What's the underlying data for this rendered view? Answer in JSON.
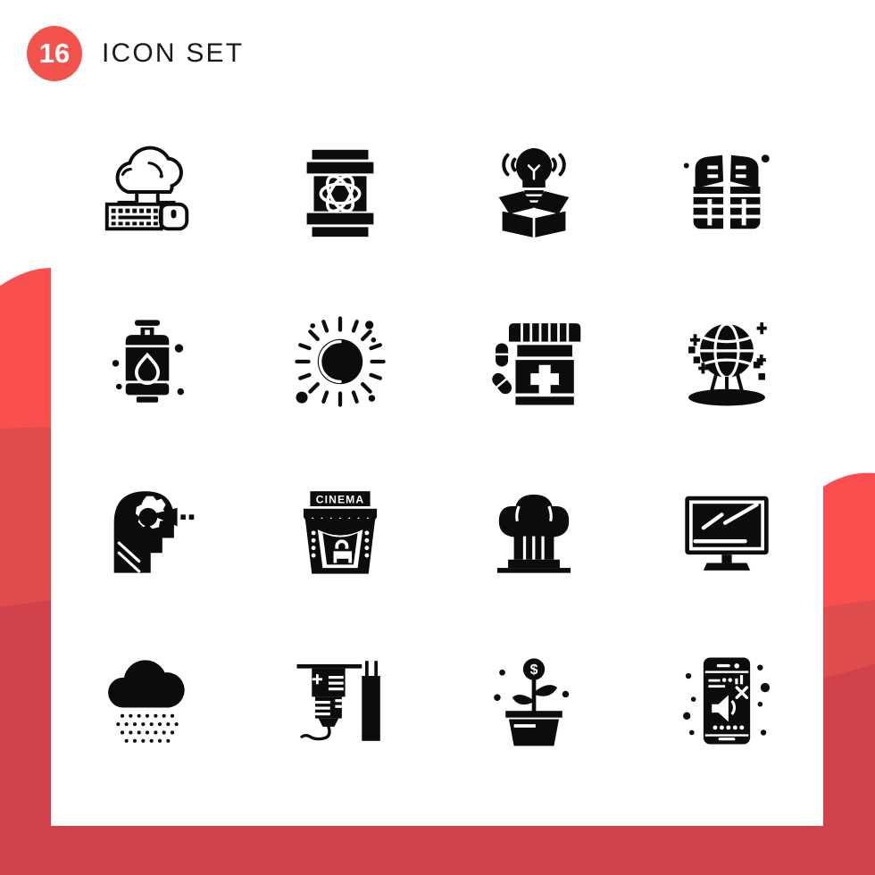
{
  "header": {
    "count": "16",
    "title": "Icon Set",
    "badge_color": "#f4534d",
    "title_color": "#1a1a1a"
  },
  "theme": {
    "background": "#ffffff",
    "accent_light": "#fb4f4f",
    "accent_mid": "#e04545",
    "accent_dark": "#d2424a",
    "icon_color": "#0c0c0c"
  },
  "grid": {
    "columns": 4,
    "rows": 4,
    "total": 16
  },
  "icons": [
    {
      "index": 1,
      "name": "cloud-computing-keyboard-mouse-icon",
      "label": "Cloud computing with keyboard and mouse"
    },
    {
      "index": 2,
      "name": "atom-barrel-icon",
      "label": "Nuclear atom barrel"
    },
    {
      "index": 3,
      "name": "idea-box-bulb-icon",
      "label": "Light bulb in open box"
    },
    {
      "index": 4,
      "name": "life-jacket-icon",
      "label": "Life jacket safety vest"
    },
    {
      "index": 5,
      "name": "gas-cylinder-icon",
      "label": "Gas cylinder with drop"
    },
    {
      "index": 6,
      "name": "sun-icon",
      "label": "Sun with rays"
    },
    {
      "index": 7,
      "name": "medicine-bottle-pills-icon",
      "label": "Medicine bottle with pills"
    },
    {
      "index": 8,
      "name": "globe-monument-icon",
      "label": "Globe sphere monument"
    },
    {
      "index": 9,
      "name": "head-gear-thinking-icon",
      "label": "Head profile with gear"
    },
    {
      "index": 10,
      "name": "cinema-building-icon",
      "label": "Cinema building",
      "sign_text": "CINEMA"
    },
    {
      "index": 11,
      "name": "chef-hat-icon",
      "label": "Chef hat"
    },
    {
      "index": 12,
      "name": "monitor-screen-icon",
      "label": "Computer monitor"
    },
    {
      "index": 13,
      "name": "rain-cloud-icon",
      "label": "Cloud with drizzle"
    },
    {
      "index": 14,
      "name": "iv-drip-icon",
      "label": "Medical IV drip"
    },
    {
      "index": 15,
      "name": "money-plant-icon",
      "label": "Money plant in pot"
    },
    {
      "index": 16,
      "name": "phone-mute-icon",
      "label": "Smartphone muted speaker"
    }
  ]
}
